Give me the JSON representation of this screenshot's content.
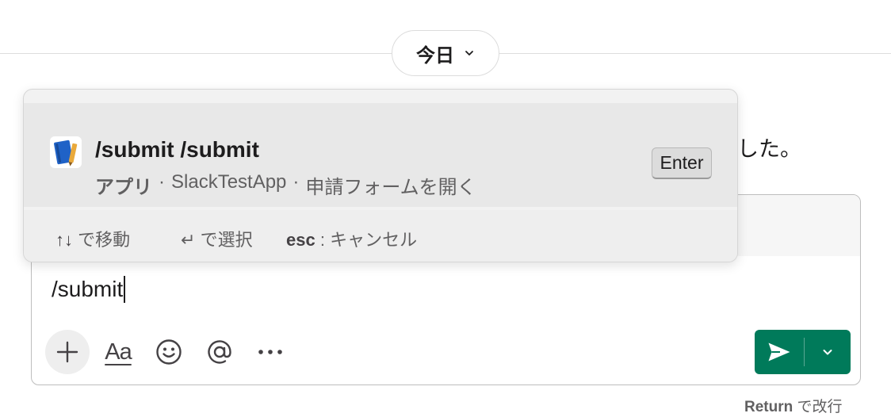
{
  "date_divider": {
    "label": "今日"
  },
  "background_message": {
    "visible_tail": "した。"
  },
  "autocomplete": {
    "suggestion": {
      "title": "/submit /submit",
      "source": "アプリ",
      "app_name": "SlackTestApp",
      "description": "申請フォームを開く",
      "key_hint": "Enter",
      "icon": "notebook-icon"
    },
    "footer": {
      "navigate_keys": "↑↓",
      "navigate_label": "で移動",
      "select_key": "↵",
      "select_label": "で選択",
      "cancel_key": "esc",
      "cancel_label": ": キャンセル"
    }
  },
  "composer": {
    "input_value": "/submit",
    "toolbar": {
      "add_icon": "plus-icon",
      "format_label": "Aa",
      "emoji_icon": "smile-icon",
      "mention_icon": "at-icon",
      "more_icon": "ellipsis-icon"
    },
    "send_color": "#007a5a"
  },
  "return_hint": {
    "key": "Return",
    "label": "で改行"
  }
}
